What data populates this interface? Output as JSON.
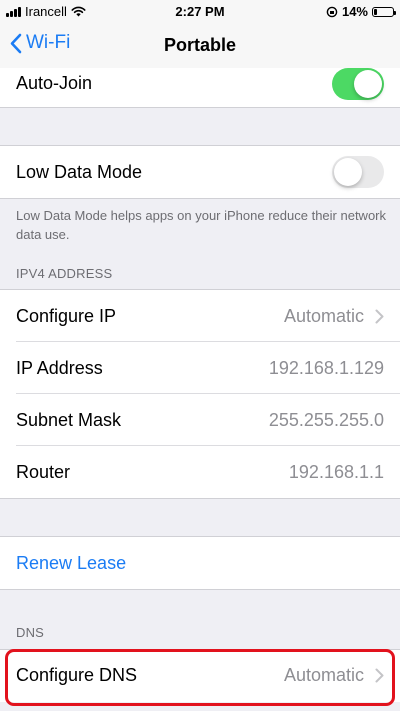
{
  "status_bar": {
    "carrier": "Irancell",
    "time": "2:27 PM",
    "battery": "14%",
    "battery_level": 0.14
  },
  "nav": {
    "back_label": "Wi-Fi",
    "title": "Portable"
  },
  "auto_join": {
    "label": "Auto-Join",
    "enabled": true
  },
  "low_data_mode": {
    "label": "Low Data Mode",
    "enabled": false,
    "footnote": "Low Data Mode helps apps on your iPhone reduce their network data use."
  },
  "ipv4": {
    "header": "IPV4 ADDRESS",
    "configure_ip": {
      "label": "Configure IP",
      "value": "Automatic"
    },
    "ip_address": {
      "label": "IP Address",
      "value": "192.168.1.129"
    },
    "subnet_mask": {
      "label": "Subnet Mask",
      "value": "255.255.255.0"
    },
    "router": {
      "label": "Router",
      "value": "192.168.1.1"
    }
  },
  "renew_lease": {
    "label": "Renew Lease"
  },
  "dns": {
    "header": "DNS",
    "configure_dns": {
      "label": "Configure DNS",
      "value": "Automatic"
    }
  },
  "colors": {
    "accent": "#1b7cf4",
    "toggle_on": "#4cd964",
    "highlight": "#e2121d",
    "background": "#efeff4"
  }
}
